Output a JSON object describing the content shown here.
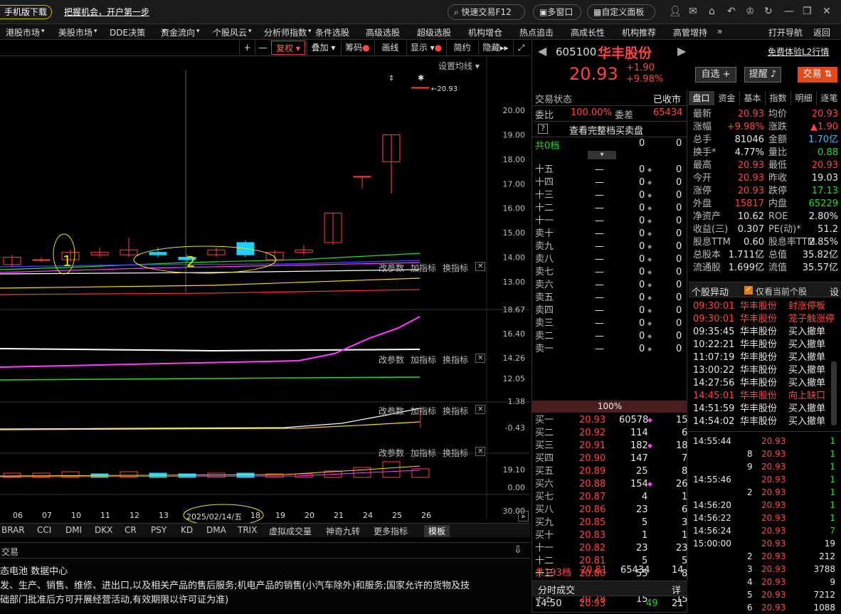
{
  "topbar": {
    "mobile_download": "手机版下载",
    "promo": "把握机会，开户第一步",
    "quick_trade": "快速交易F12",
    "multi_window": "多窗口",
    "custom_panel": "自定义面板"
  },
  "menu": [
    "港股市场",
    "美股市场",
    "DDE决策",
    "资金流向",
    "个股风云",
    "分析师指数",
    "条件选股",
    "高级选股",
    "超级选股",
    "机构增仓",
    "热点追击",
    "高成长性",
    "机构推荐",
    "高管增持",
    "»",
    "打开导航",
    "返回"
  ],
  "chart_toolbar": {
    "plus": "+",
    "minus": "—",
    "fuquan": "复权",
    "overlay": "叠加",
    "chip": "筹码",
    "draw_line": "画线",
    "display": "显示",
    "simple": "简约",
    "hide": "隐藏",
    "set_ma": "设置均线"
  },
  "chart_data": [
    {
      "type": "candlestick",
      "title": "",
      "y_ticks": [
        "20.00",
        "19.00",
        "18.00",
        "17.00",
        "16.00",
        "15.00",
        "14.00",
        "13.00"
      ],
      "x_ticks": [
        "06",
        "07",
        "10",
        "11",
        "12",
        "13",
        "2025/02/14/五",
        "18",
        "19",
        "20",
        "21",
        "24",
        "25",
        "26"
      ],
      "candles": [
        {
          "open": 13.7,
          "close": 14.0,
          "high": 14.1,
          "low": 13.6
        },
        {
          "open": 13.9,
          "close": 13.9,
          "high": 14.0,
          "low": 13.8
        },
        {
          "open": 13.9,
          "close": 14.2,
          "high": 14.3,
          "low": 13.8
        },
        {
          "open": 14.1,
          "close": 14.2,
          "high": 14.4,
          "low": 14.0
        },
        {
          "open": 14.1,
          "close": 14.3,
          "high": 14.8,
          "low": 14.0
        },
        {
          "open": 14.2,
          "close": 14.1,
          "high": 14.4,
          "low": 14.0
        },
        {
          "open": 14.0,
          "close": 13.9,
          "high": 14.1,
          "low": 13.8
        },
        {
          "open": 14.1,
          "close": 14.3,
          "high": 14.4,
          "low": 14.0
        },
        {
          "open": 14.6,
          "close": 14.1,
          "high": 14.7,
          "low": 14.0
        },
        {
          "open": 13.9,
          "close": 14.2,
          "high": 14.3,
          "low": 13.8
        },
        {
          "open": 14.2,
          "close": 14.3,
          "high": 14.5,
          "low": 14.1
        },
        {
          "open": 14.6,
          "close": 15.8,
          "high": 15.8,
          "low": 14.5
        },
        {
          "open": 17.3,
          "close": 17.3,
          "high": 17.3,
          "low": 16.8
        },
        {
          "open": 17.9,
          "close": 19.0,
          "high": 19.0,
          "low": 16.6
        },
        {
          "open": 20.93,
          "close": 20.93,
          "high": 20.93,
          "low": 20.93
        }
      ],
      "last_price_label": "20.93",
      "annotations": [
        "1",
        "2"
      ]
    },
    {
      "type": "line",
      "title": "",
      "y_ticks": [
        "18.67",
        "16.40",
        "14.26",
        "12.05"
      ],
      "series": [
        {
          "color": "#ffffff"
        },
        {
          "color": "#ff3cff"
        },
        {
          "color": "#22dd22"
        }
      ]
    },
    {
      "type": "line",
      "title": "",
      "y_ticks": [
        "1.38",
        "-0.43"
      ],
      "series": [
        {
          "color": "#ffffff"
        },
        {
          "color": "#ffd700"
        }
      ]
    },
    {
      "type": "bar",
      "title": "",
      "y_ticks": [
        "19.10",
        "0.00"
      ]
    },
    {
      "type": "line",
      "title": "",
      "y_ticks": [
        "30.00"
      ]
    }
  ],
  "indicator_controls": {
    "params": "改参数",
    "add": "加指标",
    "switch": "换指标",
    "close": "✕"
  },
  "bottom_tabs": [
    "BRAR",
    "CCI",
    "DMI",
    "DKX",
    "CR",
    "PSY",
    "KD",
    "DMA",
    "TRIX",
    "虚拟成交量",
    "神奇九转",
    "更多指标",
    "模板"
  ],
  "info_panel": {
    "title": "交易",
    "line1": "态电池 数据中心",
    "line2": "发、生产、销售、维修、进出口,以及相关产品的售后服务;机电产品的销售(小汽车除外)和服务;国家允许的货物及技",
    "line3": "础部门批准后方可开展经营活动,有效期限以许可证为准)"
  },
  "stock": {
    "code": "605100",
    "name": "华丰股份",
    "price": "20.93",
    "change": "+1.90",
    "pct": "+9.98%",
    "l2_link": "免费体验L2行情",
    "watch_btn": "自选 +",
    "alert_btn": "提醒",
    "trade_btn": "交易"
  },
  "orderbook_header": {
    "status_label": "交易状态",
    "status_value": "已收市",
    "weibi_label": "委比",
    "weibi_value": "100.00%",
    "weicha_label": "委差",
    "weicha_value": "65434",
    "full_book": "查看完整档买卖盘",
    "q_icon": "?",
    "total_levels": "共0档",
    "zero1": "0",
    "zero2": "0",
    "ratio": "100%"
  },
  "asks": [
    [
      "十五",
      "—",
      "0",
      "0"
    ],
    [
      "十四",
      "—",
      "0",
      "0"
    ],
    [
      "十三",
      "—",
      "0",
      "0"
    ],
    [
      "十二",
      "—",
      "0",
      "0"
    ],
    [
      "十一",
      "—",
      "0",
      "0"
    ],
    [
      "卖十",
      "—",
      "0",
      "0"
    ],
    [
      "卖九",
      "—",
      "0",
      "0"
    ],
    [
      "卖八",
      "—",
      "0",
      "0"
    ],
    [
      "卖七",
      "—",
      "0",
      "0"
    ],
    [
      "卖六",
      "—",
      "0",
      "0"
    ],
    [
      "卖五",
      "—",
      "0",
      "0"
    ],
    [
      "卖四",
      "—",
      "0",
      "0"
    ],
    [
      "卖三",
      "—",
      "0",
      "0"
    ],
    [
      "卖二",
      "—",
      "0",
      "0"
    ],
    [
      "卖一",
      "—",
      "0",
      "0"
    ]
  ],
  "bids": [
    [
      "买一",
      "20.93",
      "60578",
      "15"
    ],
    [
      "买二",
      "20.92",
      "114",
      "6"
    ],
    [
      "买三",
      "20.91",
      "182",
      "18"
    ],
    [
      "买四",
      "20.90",
      "147",
      "7"
    ],
    [
      "买五",
      "20.89",
      "25",
      "8"
    ],
    [
      "买六",
      "20.88",
      "154",
      "26"
    ],
    [
      "买七",
      "20.87",
      "4",
      "1"
    ],
    [
      "买八",
      "20.86",
      "23",
      "6"
    ],
    [
      "买九",
      "20.85",
      "5",
      "3"
    ],
    [
      "买十",
      "20.83",
      "1",
      "1"
    ],
    [
      "十一",
      "20.82",
      "23",
      "23"
    ],
    [
      "十二",
      "20.81",
      "5",
      "5"
    ],
    [
      "十三",
      "20.80",
      "55",
      "8"
    ],
    [
      "十四",
      "20.79",
      "12",
      "12"
    ],
    [
      "十五",
      "20.78",
      "15",
      "15"
    ]
  ],
  "bid_total": {
    "label": "共193档",
    "price": "20.81",
    "vol": "65434",
    "count": "14"
  },
  "time_trades": {
    "label": "分时成交",
    "detail": "详",
    "time": "14:50",
    "price": "20.93",
    "vol": "49",
    "count": "21"
  },
  "quote_tabs": [
    "盘口",
    "资金",
    "基本",
    "指数",
    "明细",
    "逐笔"
  ],
  "quote": [
    [
      "最新",
      "20.93",
      "均价",
      "20.93"
    ],
    [
      "涨幅",
      "+9.98%",
      "涨跌",
      "▲1.90"
    ],
    [
      "总手",
      "81046",
      "金额",
      "1.70亿"
    ],
    [
      "换手*",
      "4.77%",
      "量比",
      "0.88"
    ],
    [
      "最高",
      "20.93",
      "最低",
      "20.93"
    ],
    [
      "今开",
      "20.93",
      "昨收",
      "19.03"
    ],
    [
      "涨停",
      "20.93",
      "跌停",
      "17.13"
    ],
    [
      "外盘",
      "15817",
      "内盘",
      "65229"
    ],
    [
      "净资产",
      "10.62",
      "ROE",
      "2.80%"
    ],
    [
      "收益(三)",
      "0.307",
      "PE(动)*",
      "51.2"
    ],
    [
      "股息TTM",
      "0.60",
      "股息率TTM",
      "2.85%"
    ],
    [
      "总股本",
      "1.711亿",
      "总值",
      "35.82亿"
    ],
    [
      "流通股",
      "1.699亿",
      "流值",
      "35.57亿"
    ]
  ],
  "events_header": {
    "title": "个股异动",
    "checkbox": "仅看当前个股",
    "settings": "设"
  },
  "events": [
    [
      "09:30:01",
      "华丰股份",
      "封涨停板"
    ],
    [
      "09:30:01",
      "华丰股份",
      "笼子触涨停"
    ],
    [
      "09:35:45",
      "华丰股份",
      "买入撤单"
    ],
    [
      "10:22:21",
      "华丰股份",
      "买入撤单"
    ],
    [
      "11:07:19",
      "华丰股份",
      "买入撤单"
    ],
    [
      "13:00:22",
      "华丰股份",
      "买入撤单"
    ],
    [
      "14:27:56",
      "华丰股份",
      "买入撤单"
    ],
    [
      "14:45:01",
      "华丰股份",
      "向上缺口"
    ],
    [
      "14:51:59",
      "华丰股份",
      "买入撤单"
    ],
    [
      "14:54:02",
      "华丰股份",
      "买入撤单"
    ]
  ],
  "ticks": [
    [
      "14:55:44",
      "20.93",
      "1"
    ],
    [
      "8",
      "20.93",
      "1"
    ],
    [
      "9",
      "20.93",
      "1"
    ],
    [
      "14:55:46",
      "20.93",
      "1"
    ],
    [
      "2",
      "20.93",
      "1"
    ],
    [
      "14:56:20",
      "20.93",
      "1"
    ],
    [
      "14:56:22",
      "20.93",
      "1"
    ],
    [
      "14:56:24",
      "20.93",
      "7"
    ],
    [
      "15:00:00",
      "20.93",
      "19"
    ],
    [
      "2",
      "20.93",
      "212"
    ],
    [
      "3",
      "20.93",
      "3788"
    ],
    [
      "4",
      "20.93",
      "9"
    ],
    [
      "5",
      "20.93",
      "7212"
    ],
    [
      "6",
      "20.93",
      "1088"
    ]
  ]
}
